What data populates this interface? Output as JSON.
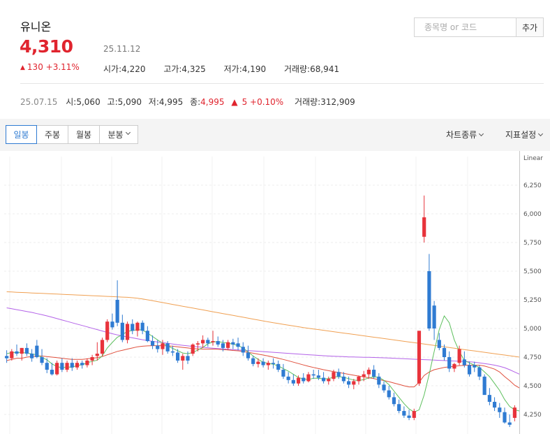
{
  "stock": {
    "name": "유니온",
    "price": "4,310",
    "date": "25.11.12",
    "change": "130 +3.11%",
    "stats": {
      "open": "시가:4,220",
      "high": "고가:4,325",
      "low": "저가:4,190",
      "volume": "거래량:68,941"
    }
  },
  "search": {
    "placeholder": "종목명 or 코드",
    "add_label": "추가"
  },
  "history": {
    "date": "25.07.15",
    "open": "시:5,060",
    "high": "고:5,090",
    "low": "저:4,995",
    "close_label": "종:",
    "close": "4,995",
    "change": "5 +0.10%",
    "volume": "거래량:312,909"
  },
  "toolbar": {
    "tabs": [
      "일봉",
      "주봉",
      "월봉",
      "분봉"
    ],
    "active_tab": "일봉",
    "chart_type": "차트종류",
    "indicator": "지표설정"
  },
  "colors": {
    "up": "#e8333b",
    "down": "#2f7bd2",
    "ma5": "#5dbf5d",
    "ma20": "#e04f3c",
    "ma60": "#b362e8",
    "ma120": "#f0a052"
  },
  "chart_data": {
    "type": "candlestick",
    "scale": "Linear",
    "ylim": [
      4150,
      6400
    ],
    "yticks": [
      "6,250",
      "6,000",
      "5,750",
      "5,500",
      "5,250",
      "5,000",
      "4,750",
      "4,500",
      "4,250"
    ],
    "ytick_values": [
      6250,
      6000,
      5750,
      5500,
      5250,
      5000,
      4750,
      4500,
      4250
    ],
    "candles": [
      [
        4760,
        4810,
        4700,
        4740
      ],
      [
        4740,
        4820,
        4720,
        4800
      ],
      [
        4800,
        4860,
        4760,
        4780
      ],
      [
        4780,
        4830,
        4720,
        4830
      ],
      [
        4830,
        4870,
        4760,
        4780
      ],
      [
        4780,
        4820,
        4710,
        4740
      ],
      [
        4850,
        4900,
        4740,
        4750
      ],
      [
        4750,
        4820,
        4680,
        4700
      ],
      [
        4700,
        4740,
        4610,
        4640
      ],
      [
        4640,
        4700,
        4590,
        4600
      ],
      [
        4600,
        4720,
        4590,
        4700
      ],
      [
        4700,
        4740,
        4620,
        4640
      ],
      [
        4640,
        4720,
        4620,
        4700
      ],
      [
        4700,
        4740,
        4630,
        4660
      ],
      [
        4660,
        4720,
        4640,
        4700
      ],
      [
        4700,
        4720,
        4650,
        4680
      ],
      [
        4680,
        4740,
        4660,
        4720
      ],
      [
        4720,
        4770,
        4680,
        4750
      ],
      [
        4760,
        4880,
        4720,
        4780
      ],
      [
        4780,
        4920,
        4760,
        4900
      ],
      [
        4900,
        5080,
        4880,
        5060
      ],
      [
        5060,
        5130,
        4990,
        5010
      ],
      [
        5250,
        5420,
        5020,
        5050
      ],
      [
        5050,
        5120,
        4880,
        4900
      ],
      [
        4900,
        5060,
        4870,
        5040
      ],
      [
        5040,
        5080,
        4950,
        4980
      ],
      [
        4980,
        5060,
        4930,
        5050
      ],
      [
        5050,
        5070,
        4950,
        4980
      ],
      [
        4980,
        5020,
        4880,
        4890
      ],
      [
        4890,
        4940,
        4820,
        4850
      ],
      [
        4850,
        4900,
        4790,
        4820
      ],
      [
        4820,
        4900,
        4770,
        4870
      ],
      [
        4870,
        4890,
        4780,
        4800
      ],
      [
        4800,
        4850,
        4760,
        4790
      ],
      [
        4790,
        4820,
        4700,
        4720
      ],
      [
        4720,
        4780,
        4640,
        4760
      ],
      [
        4760,
        4800,
        4690,
        4720
      ],
      [
        4780,
        4870,
        4760,
        4860
      ],
      [
        4860,
        4890,
        4800,
        4870
      ],
      [
        4870,
        4940,
        4830,
        4900
      ],
      [
        4900,
        4920,
        4840,
        4870
      ],
      [
        4880,
        4980,
        4850,
        4890
      ],
      [
        4890,
        4930,
        4840,
        4860
      ],
      [
        4870,
        4900,
        4800,
        4830
      ],
      [
        4830,
        4900,
        4810,
        4880
      ],
      [
        4880,
        4910,
        4820,
        4860
      ],
      [
        4870,
        4920,
        4810,
        4840
      ],
      [
        4840,
        4880,
        4760,
        4790
      ],
      [
        4790,
        4850,
        4720,
        4740
      ],
      [
        4740,
        4760,
        4670,
        4690
      ],
      [
        4690,
        4740,
        4660,
        4710
      ],
      [
        4710,
        4740,
        4660,
        4680
      ],
      [
        4680,
        4720,
        4640,
        4700
      ],
      [
        4700,
        4740,
        4650,
        4690
      ],
      [
        4690,
        4720,
        4620,
        4640
      ],
      [
        4640,
        4690,
        4560,
        4580
      ],
      [
        4580,
        4620,
        4520,
        4550
      ],
      [
        4550,
        4600,
        4500,
        4520
      ],
      [
        4520,
        4590,
        4500,
        4570
      ],
      [
        4570,
        4610,
        4520,
        4540
      ],
      [
        4540,
        4620,
        4530,
        4600
      ],
      [
        4600,
        4640,
        4560,
        4590
      ],
      [
        4590,
        4640,
        4550,
        4570
      ],
      [
        4570,
        4620,
        4520,
        4540
      ],
      [
        4540,
        4580,
        4510,
        4560
      ],
      [
        4560,
        4640,
        4540,
        4620
      ],
      [
        4620,
        4650,
        4560,
        4580
      ],
      [
        4580,
        4620,
        4520,
        4540
      ],
      [
        4540,
        4580,
        4480,
        4510
      ],
      [
        4510,
        4560,
        4470,
        4540
      ],
      [
        4540,
        4590,
        4510,
        4580
      ],
      [
        4580,
        4630,
        4540,
        4600
      ],
      [
        4600,
        4660,
        4560,
        4640
      ],
      [
        4640,
        4680,
        4560,
        4580
      ],
      [
        4580,
        4610,
        4480,
        4510
      ],
      [
        4510,
        4540,
        4440,
        4460
      ],
      [
        4460,
        4500,
        4380,
        4400
      ],
      [
        4400,
        4440,
        4320,
        4340
      ],
      [
        4340,
        4380,
        4260,
        4280
      ],
      [
        4280,
        4320,
        4220,
        4240
      ],
      [
        4240,
        4290,
        4200,
        4220
      ],
      [
        4220,
        4300,
        4200,
        4280
      ],
      [
        4520,
        4950,
        4500,
        4980
      ],
      [
        5800,
        6160,
        5750,
        5970
      ],
      [
        5500,
        5650,
        4980,
        5000
      ],
      [
        5200,
        5240,
        4900,
        5000
      ],
      [
        4900,
        4960,
        4810,
        4830
      ],
      [
        4830,
        4860,
        4720,
        4750
      ],
      [
        4750,
        4800,
        4620,
        4650
      ],
      [
        4650,
        4700,
        4620,
        4690
      ],
      [
        4700,
        4850,
        4680,
        4820
      ],
      [
        4730,
        4800,
        4660,
        4680
      ],
      [
        4680,
        4710,
        4580,
        4600
      ],
      [
        4680,
        4710,
        4620,
        4660
      ],
      [
        4660,
        4680,
        4550,
        4580
      ],
      [
        4580,
        4600,
        4450,
        4420
      ],
      [
        4420,
        4480,
        4330,
        4360
      ],
      [
        4360,
        4400,
        4280,
        4310
      ],
      [
        4310,
        4350,
        4220,
        4270
      ],
      [
        4270,
        4310,
        4170,
        4180
      ],
      [
        4180,
        4250,
        4140,
        4160
      ],
      [
        4220,
        4330,
        4190,
        4310
      ]
    ],
    "ma5": [
      4780,
      4790,
      4790,
      4790,
      4785,
      4778,
      4770,
      4748,
      4726,
      4690,
      4668,
      4656,
      4666,
      4660,
      4680,
      4682,
      4702,
      4712,
      4724,
      4760,
      4830,
      4878,
      4924,
      4946,
      4975,
      4982,
      4990,
      4986,
      4960,
      4930,
      4900,
      4872,
      4848,
      4826,
      4806,
      4786,
      4780,
      4790,
      4812,
      4834,
      4866,
      4882,
      4886,
      4878,
      4872,
      4862,
      4852,
      4830,
      4796,
      4760,
      4730,
      4706,
      4696,
      4688,
      4674,
      4650,
      4628,
      4600,
      4572,
      4560,
      4554,
      4566,
      4566,
      4560,
      4562,
      4576,
      4580,
      4574,
      4562,
      4550,
      4546,
      4554,
      4568,
      4578,
      4574,
      4548,
      4510,
      4454,
      4398,
      4344,
      4298,
      4270,
      4290,
      4420,
      4600,
      4800,
      4990,
      5110,
      5050,
      4900,
      4800,
      4720,
      4700,
      4680,
      4660,
      4620,
      4580,
      4520,
      4460,
      4380,
      4320,
      4290,
      4280
    ],
    "ma20": [
      4720,
      4730,
      4740,
      4740,
      4750,
      4755,
      4760,
      4760,
      4755,
      4750,
      4745,
      4740,
      4735,
      4730,
      4730,
      4730,
      4735,
      4740,
      4745,
      4755,
      4770,
      4785,
      4800,
      4810,
      4820,
      4830,
      4840,
      4845,
      4848,
      4850,
      4850,
      4850,
      4848,
      4845,
      4840,
      4835,
      4830,
      4825,
      4822,
      4820,
      4820,
      4820,
      4818,
      4815,
      4812,
      4808,
      4805,
      4800,
      4792,
      4784,
      4776,
      4768,
      4760,
      4750,
      4740,
      4730,
      4718,
      4706,
      4694,
      4682,
      4670,
      4660,
      4650,
      4640,
      4632,
      4624,
      4616,
      4608,
      4600,
      4592,
      4585,
      4578,
      4570,
      4562,
      4554,
      4546,
      4536,
      4524,
      4512,
      4500,
      4490,
      4490,
      4530,
      4590,
      4620,
      4640,
      4650,
      4660,
      4665,
      4670,
      4675,
      4678,
      4680,
      4680,
      4680,
      4672,
      4660,
      4645,
      4620,
      4580,
      4545,
      4505,
      4480
    ],
    "ma60": [
      5180,
      5172,
      5164,
      5156,
      5148,
      5140,
      5130,
      5120,
      5110,
      5098,
      5086,
      5074,
      5062,
      5050,
      5038,
      5026,
      5014,
      5002,
      4990,
      4978,
      4966,
      4954,
      4944,
      4934,
      4926,
      4918,
      4910,
      4902,
      4895,
      4888,
      4882,
      4876,
      4870,
      4864,
      4858,
      4853,
      4848,
      4844,
      4840,
      4836,
      4832,
      4828,
      4825,
      4822,
      4819,
      4816,
      4813,
      4810,
      4807,
      4804,
      4801,
      4798,
      4795,
      4792,
      4789,
      4786,
      4783,
      4780,
      4777,
      4774,
      4771,
      4768,
      4765,
      4762,
      4760,
      4758,
      4756,
      4754,
      4752,
      4751,
      4750,
      4749,
      4748,
      4747,
      4746,
      4744,
      4742,
      4740,
      4738,
      4736,
      4734,
      4732,
      4730,
      4728,
      4726,
      4724,
      4722,
      4720,
      4718,
      4716,
      4714,
      4712,
      4710,
      4706,
      4700,
      4694,
      4688,
      4680,
      4670,
      4658,
      4640,
      4620,
      4600
    ],
    "ma120": [
      5320,
      5318,
      5316,
      5314,
      5312,
      5310,
      5308,
      5306,
      5304,
      5302,
      5300,
      5298,
      5296,
      5294,
      5292,
      5290,
      5288,
      5286,
      5284,
      5282,
      5280,
      5278,
      5276,
      5274,
      5272,
      5268,
      5264,
      5258,
      5250,
      5242,
      5234,
      5226,
      5218,
      5210,
      5202,
      5194,
      5186,
      5178,
      5170,
      5162,
      5154,
      5146,
      5138,
      5130,
      5122,
      5114,
      5106,
      5098,
      5090,
      5082,
      5074,
      5066,
      5058,
      5050,
      5043,
      5036,
      5029,
      5022,
      5015,
      5008,
      5002,
      4996,
      4990,
      4984,
      4978,
      4972,
      4966,
      4960,
      4954,
      4948,
      4942,
      4936,
      4930,
      4924,
      4918,
      4912,
      4906,
      4900,
      4894,
      4888,
      4882,
      4876,
      4870,
      4864,
      4858,
      4852,
      4846,
      4840,
      4834,
      4828,
      4822,
      4816,
      4810,
      4804,
      4798,
      4792,
      4786,
      4780,
      4774,
      4768,
      4762,
      4756,
      4750
    ]
  }
}
